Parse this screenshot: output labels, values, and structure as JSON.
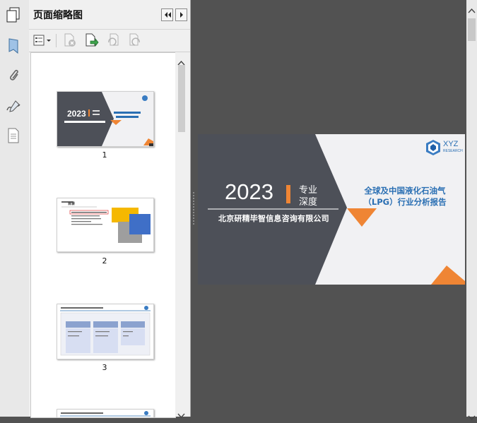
{
  "panel": {
    "title": "页面缩略图"
  },
  "thumbnails": [
    {
      "page": "1"
    },
    {
      "page": "2",
      "toc_heading": "目录"
    },
    {
      "page": "3"
    }
  ],
  "slide": {
    "year": "2023",
    "tag_line1": "专业",
    "tag_line2": "深度",
    "company": "北京研精毕智信息咨询有限公司",
    "report_title_line1": "全球及中国液化石油气",
    "report_title_line2": "（LPG）行业分析报告",
    "logo_text": "XYZ",
    "logo_sub": "RESEARCH"
  },
  "colors": {
    "slide_dark": "#4d5058",
    "accent_orange": "#ef8534",
    "title_blue": "#2a6fb3",
    "doc_bg": "#525252"
  }
}
